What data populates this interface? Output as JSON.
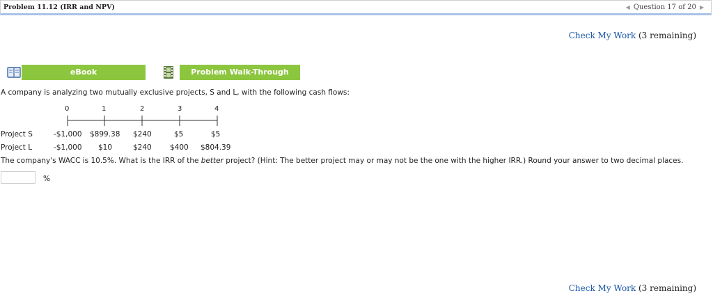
{
  "header": {
    "problem_title": "Problem 11.12 (IRR and NPV)",
    "question_counter": "Question 17 of 20"
  },
  "check_my_work": {
    "link_label": "Check My Work",
    "remaining": "(3 remaining)"
  },
  "buttons": {
    "ebook_label": "eBook",
    "walkthrough_label": "Problem Walk-Through"
  },
  "problem": {
    "intro": "A company is analyzing two mutually exclusive projects, S and L, with the following cash flows:",
    "question_part1": "The company's WACC is 10.5%. What is the IRR of the ",
    "question_emph": "better",
    "question_part2": " project? (Hint: The better project may or may not be the one with the higher IRR.) Round your answer to two decimal places."
  },
  "timeline": {
    "periods": [
      "0",
      "1",
      "2",
      "3",
      "4"
    ]
  },
  "projects": [
    {
      "name": "Project S",
      "flows": [
        "-$1,000",
        "$899.38",
        "$240",
        "$5",
        "$5"
      ]
    },
    {
      "name": "Project L",
      "flows": [
        "-$1,000",
        "$10",
        "$240",
        "$400",
        "$804.39"
      ]
    }
  ],
  "answer": {
    "value": "",
    "unit": "%"
  },
  "colors": {
    "button_green": "#8cc63f",
    "link_blue": "#1a56a8",
    "header_rule_blue": "#a9c3e6"
  },
  "icons": {
    "ebook": "book-icon",
    "walkthrough": "film-icon",
    "prev": "triangle-left-icon",
    "next": "triangle-right-icon"
  }
}
